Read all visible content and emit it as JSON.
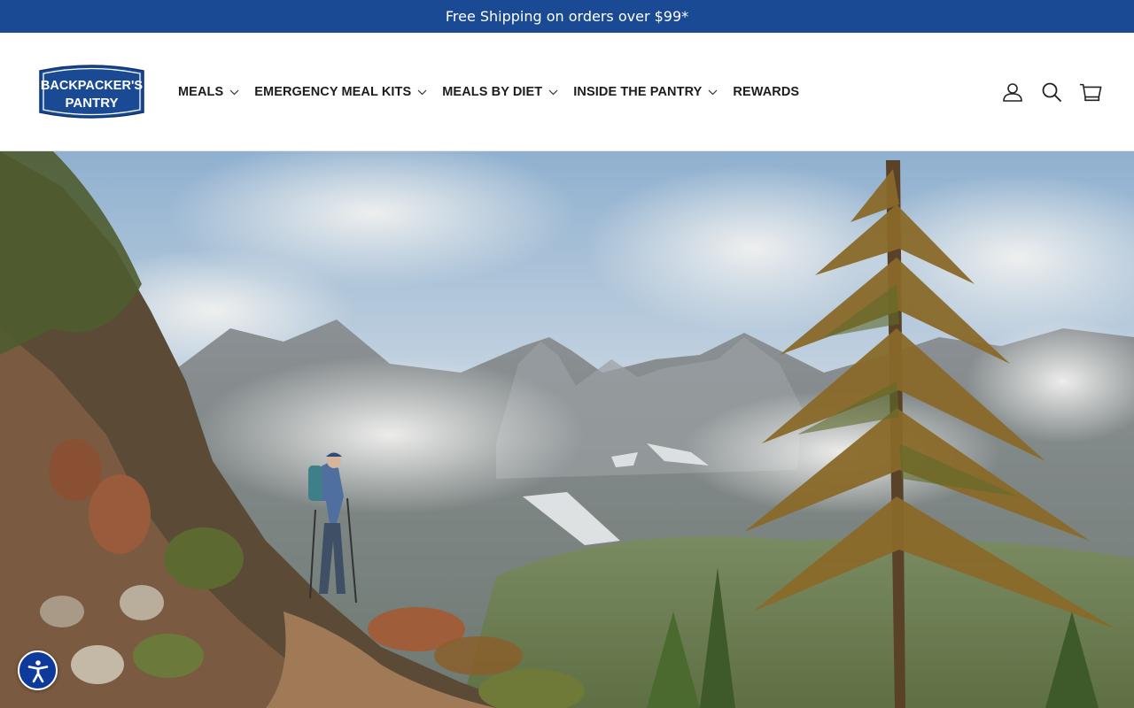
{
  "announcement": {
    "text": "Free Shipping on orders over $99*"
  },
  "brand": {
    "logo_line1": "BACKPACKER'S",
    "logo_line2": "PANTRY",
    "color": "#1a4a93"
  },
  "nav": {
    "items": [
      {
        "label": "MEALS",
        "has_dropdown": true
      },
      {
        "label": "EMERGENCY MEAL KITS",
        "has_dropdown": true
      },
      {
        "label": "MEALS BY DIET",
        "has_dropdown": true
      },
      {
        "label": "INSIDE THE PANTRY",
        "has_dropdown": true
      },
      {
        "label": "REWARDS",
        "has_dropdown": false
      }
    ]
  },
  "header_icons": [
    "account-icon",
    "search-icon",
    "cart-icon"
  ],
  "hero": {
    "image": "hiker-on-mountain-trail"
  },
  "accessibility": {
    "icon": "accessibility-icon"
  }
}
